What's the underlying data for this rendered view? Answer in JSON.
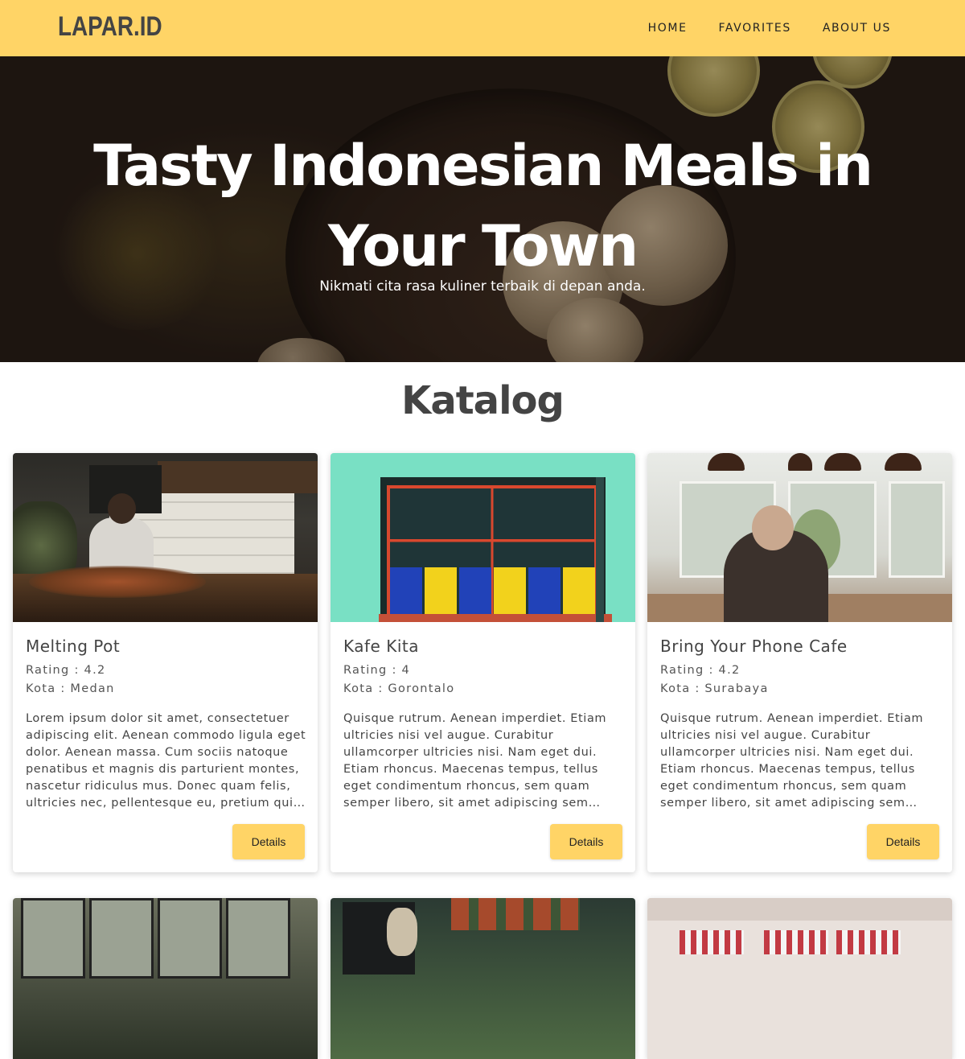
{
  "header": {
    "logo": "LAPAR.ID",
    "nav": [
      "HOME",
      "FAVORITES",
      "ABOUT US"
    ]
  },
  "hero": {
    "title": "Tasty Indonesian Meals in Your Town",
    "subtitle": "Nikmati cita rasa kuliner terbaik di depan anda."
  },
  "catalog": {
    "title": "Katalog",
    "details_label": "Details",
    "restaurants": [
      {
        "name": "Melting Pot",
        "rating": "Rating : 4.2",
        "city": "Kota : Medan",
        "description": "Lorem ipsum dolor sit amet, consectetuer adipiscing elit. Aenean commodo ligula eget dolor. Aenean massa. Cum sociis natoque penatibus et magnis dis parturient montes, nascetur ridiculus mus. Donec quam felis, ultricies nec, pellentesque eu, pretium quis, sem."
      },
      {
        "name": "Kafe Kita",
        "rating": "Rating : 4",
        "city": "Kota : Gorontalo",
        "description": "Quisque rutrum. Aenean imperdiet. Etiam ultricies nisi vel augue. Curabitur ullamcorper ultricies nisi. Nam eget dui. Etiam rhoncus. Maecenas tempus, tellus eget condimentum rhoncus, sem quam semper libero, sit amet adipiscing sem neque sed ipsum."
      },
      {
        "name": "Bring Your Phone Cafe",
        "rating": "Rating : 4.2",
        "city": "Kota : Surabaya",
        "description": "Quisque rutrum. Aenean imperdiet. Etiam ultricies nisi vel augue. Curabitur ullamcorper ultricies nisi. Nam eget dui. Etiam rhoncus. Maecenas tempus, tellus eget condimentum rhoncus, sem quam semper libero, sit amet adipiscing sem neque sed ipsum."
      }
    ]
  },
  "colors": {
    "accent": "#ffd466",
    "text": "#444444"
  }
}
